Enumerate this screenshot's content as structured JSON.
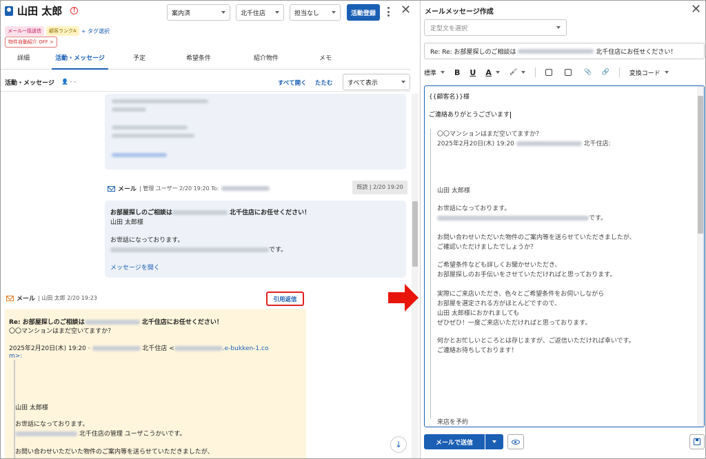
{
  "customer": {
    "name": "山田 太郎",
    "tags": [
      "メール一括送信",
      "顧客ランクA"
    ],
    "add_tag": "+ タグ選択",
    "auto_intro": "物件自動紹介 OFF >"
  },
  "header": {
    "status_select": "案内済",
    "store_select": "北千住店",
    "staff_select": "担当なし",
    "register_button": "活動登録"
  },
  "tabs": [
    "詳細",
    "活動・メッセージ",
    "予定",
    "希望条件",
    "紹介物件",
    "メモ"
  ],
  "activity": {
    "title": "活動・メッセージ",
    "filter_text": "- -",
    "open_all": "すべて開く",
    "fold": "たたむ",
    "show_select": "すべて表示"
  },
  "sent_mail": {
    "kind": "メール",
    "meta": "| 管理 ユーザー 2/20 19:20 To:",
    "read_badge": "既読 | 2/20 19:20",
    "subject_pre": "お部屋探しのご相談は",
    "subject_post": "北千住店にお任せください！",
    "line1": "山田 太郎様",
    "line2": "お世話になっております。",
    "line3_post": "です。",
    "open_link": "メッセージを開く"
  },
  "recv_mail": {
    "kind": "メール",
    "meta": "| 山田 太郎 2/20 19:23",
    "quote_button": "引用返信",
    "subject_pre": "Re: お部屋探しのご相談は",
    "subject_post": "北千住店にお任せください！",
    "line1": "〇〇マンションはまだ空いてますか？",
    "date_line_pre": "2025年2月20日(木) 19:20 ·",
    "date_line_mid": "北千住店 <",
    "email_tail": ".e-bukken-1.co",
    "email_tail2": "m>:",
    "q1": "山田 太郎様",
    "q2": "お世話になっております。",
    "q3": "北千住店の管理 ユーザこうかいです。",
    "q4": "お問い合わせいただいた物件のご案内等を送らせていただきましたが、"
  },
  "compose": {
    "title": "メールメッセージ作成",
    "template_placeholder": "定型文を選択",
    "subject_pre": "Re: Re: お部屋探しのご相談は",
    "subject_post": "北千住店にお任せください！",
    "toolbar_style": "標準",
    "toolbar_bold": "B",
    "toolbar_underline": "U",
    "toolbar_color": "A",
    "toolbar_code": "変換コード",
    "body": {
      "greeting": "{{顧客名}}様",
      "thanks": "ご連絡ありがとうございます",
      "q_line1": "〇〇マンションはまだ空いてますか？",
      "q_date": "2025年2月20日(木) 19:20",
      "q_store": "北千住店:",
      "q_name": "山田 太郎様",
      "q_greet": "お世話になっております。",
      "q_desu": "です。",
      "q_p1a": "お問い合わせいただいた物件のご案内等を送らせていただきましたが、",
      "q_p1b": "ご確認いただけましたでしょうか？",
      "q_p2a": "ご希望条件なども詳しくお聞かせいただき、",
      "q_p2b": "お部屋探しのお手伝いをさせていただければと思っております。",
      "q_p3a": "実際にご来店いただき、色々とご希望条件をお伺いしながら",
      "q_p3b": "お部屋を選定される方がほとんどですので、",
      "q_p3c": "山田 太郎様におかれましても",
      "q_p3d": "ぜひぜひ！一度ご来店いただければと思っております。",
      "q_p4a": "何かとお忙しいところとは存じますが、ご返信いただければ幸いです。",
      "q_p4b": "ご連絡お待ちしております！",
      "q_last": "来店を予約"
    },
    "send_button": "メールで送信"
  },
  "colors": {
    "primary": "#1a5fb4",
    "highlight": "#e02020"
  }
}
